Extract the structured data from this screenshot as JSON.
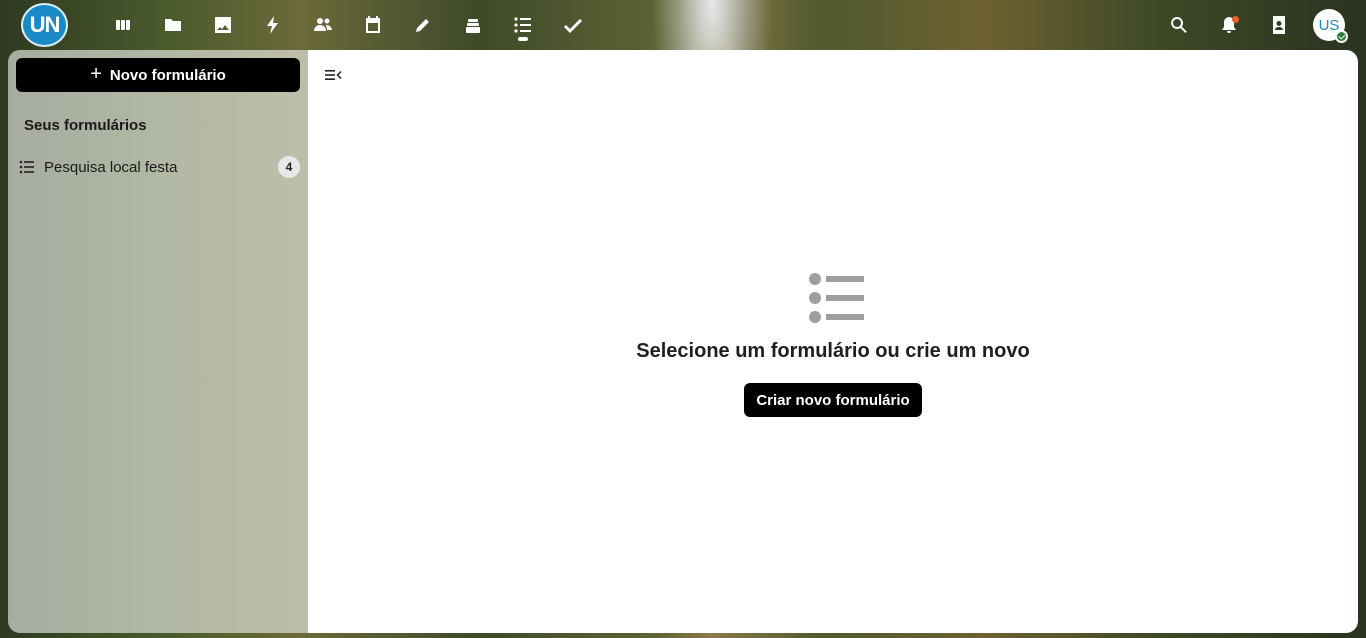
{
  "header": {
    "logo_text": "UN",
    "apps": [
      {
        "name": "dashboard-icon"
      },
      {
        "name": "files-icon"
      },
      {
        "name": "photos-icon"
      },
      {
        "name": "activity-icon"
      },
      {
        "name": "contacts-icon"
      },
      {
        "name": "calendar-icon"
      },
      {
        "name": "notes-icon"
      },
      {
        "name": "deck-icon"
      },
      {
        "name": "forms-icon",
        "active": true
      },
      {
        "name": "tasks-icon"
      }
    ],
    "avatar_initials": "US",
    "notification_color": "#e9622b",
    "accent_color": "#1a8ac6"
  },
  "sidebar": {
    "new_form_label": "Novo formulário",
    "section_title": "Seus formulários",
    "forms": [
      {
        "label": "Pesquisa local festa",
        "count": "4"
      }
    ]
  },
  "main": {
    "empty_title": "Selecione um formulário ou crie um novo",
    "create_label": "Criar novo formulário"
  }
}
